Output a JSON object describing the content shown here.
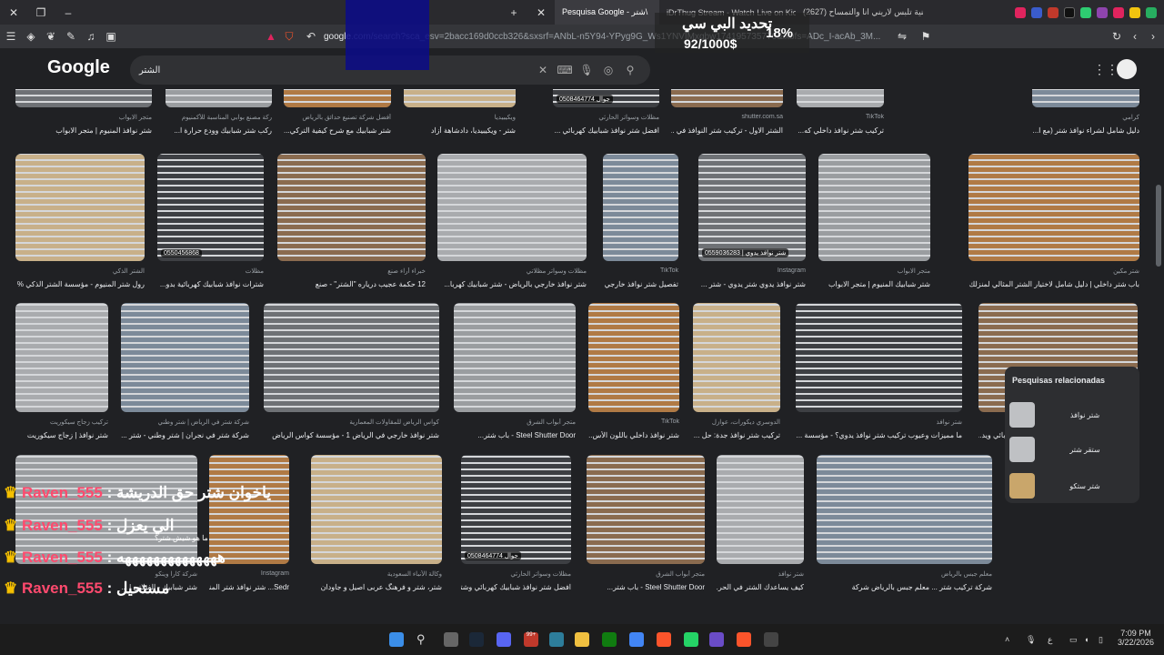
{
  "browser": {
    "tabs": [
      {
        "label": "",
        "active": false
      },
      {
        "label": "Pesquisa Google - شتر\\",
        "active": true
      },
      {
        "label": "iDrThug Stream - Watch Live on Kick",
        "active": false
      },
      {
        "label": "(2627) اغنية تلبس لاريني انا والتمساح",
        "active": false
      }
    ],
    "url_host": "google",
    "url_rest": ".com/search?sca_esv=2bacc169d0ccb326&sxsrf=ANbL-n5Y94-YPyg9G_Ws1YNVIMxgbw174195735776&ixbfs=ADc_I-acAb_3M..."
  },
  "google": {
    "logo": "Google",
    "query": "الشتر"
  },
  "overlay": {
    "line1": "تحديد البي سي",
    "line2": "92/1000$",
    "percent": "18%"
  },
  "results": {
    "row0": [
      {
        "src": "متجر الابواب",
        "title": "شتر نوافذ المنيوم | متجر الابواب"
      },
      {
        "src": "ركة مصنع بوابي المناسبة للأكمنيوم",
        "title": "ركب شتر شبابيك وودع حرارة ا..."
      },
      {
        "src": "أفضل شركة تصنيع حدائق بالرياض",
        "title": "شتر شبابيك مع شرح كيفية التركي..."
      },
      {
        "src": "ويكيبيديا",
        "title": "شتر - ويكيبيديا، دادشاهة أزاد"
      },
      {
        "src": "مظلات وسواتر الحارثي",
        "title": "افضل شتر نوافذ شبابيك كهربائي ..."
      },
      {
        "src": "shutter.com.sa",
        "title": "الشتر الاول - تركيب شتر النوافذ في ..."
      },
      {
        "src": "TikTok",
        "title": "تركيب شتر نوافذ داخلي كه..."
      },
      {
        "src": "كرامي",
        "title": "دليل شامل لشراء نوافذ شتر (مع ا..."
      }
    ],
    "row1": [
      {
        "src": "الشتر الذكي",
        "title": "رول شتر المنيوم - مؤسسة الشتر الذكي %"
      },
      {
        "src": "مظلات",
        "title": "شترات نوافذ شبابيك كهربائية بدو..."
      },
      {
        "src": "خبراء أراء صنع",
        "title": "12 حكمة عجيب درياره \"الشتر\" - صنع"
      },
      {
        "src": "مظلات وسواتر مظلاتي",
        "title": "شتر نوافذ خارجي بالرياض - شتر شبابيك كهربا..."
      },
      {
        "src": "TikTok",
        "title": "تفصيل شتر نوافذ خارجي ..."
      },
      {
        "src": "Instagram",
        "title": "شتر نوافذ يدوي شتر يدوي - شتر ..."
      },
      {
        "src": "متجر الابواب",
        "title": "شتر شبابيك المنيوم | متجر الابواب"
      },
      {
        "src": "شتر مكين",
        "title": "باب شتر داخلي | دليل شامل لاختيار الشتر المثالي لمنزلك"
      }
    ],
    "row2": [
      {
        "src": "تركيب زجاج سيكوريت",
        "title": "شتر نوافذ | زجاج سيكوريت"
      },
      {
        "src": "شركة شتر في الرياض | شتر وطني",
        "title": "شركة شتر في نجران | شتر وطني - شتر ..."
      },
      {
        "src": "كواس الرياض للمقاولات المعمارية",
        "title": "شتر نوافذ خارجي في الرياض 1 - مؤسسة كواس الرياض"
      },
      {
        "src": "متجر أبواب الشرق",
        "title": "Steel Shutter Door - باب شتر..."
      },
      {
        "src": "TikTok",
        "title": "شتر نوافذ داخلي باللون الأس..."
      },
      {
        "src": "الدوسري ديكورات، عوازل",
        "title": "تركيب شتر نوافذ جدة: حل ..."
      },
      {
        "src": "شتر نوافذ",
        "title": "ما مميزات وعيوب تركيب شتر نوافذ يدوي؟ - مؤسسة ..."
      },
      {
        "src": "مظلات وسواتر مظلاتي",
        "title": "شتر نوافذ خارجي بالرياض - شتر شبابيك كهربائي ويد..."
      }
    ],
    "row3": [
      {
        "src": "شركة كارا وينكو",
        "title": "شتر شبابيك - الفيلاتي | ..."
      },
      {
        "src": "Instagram",
        "title": "Sedr... شتر نوافذ شتر المنيوم"
      },
      {
        "src": "وكالة الأنباء السعودية",
        "title": "شتر، شتر و فرهنگ عربی اصیل و جاودان"
      },
      {
        "src": "مظلات وسواتر الحارثي",
        "title": "افضل شتر نوافذ شبابيك كهربائي وشتر..."
      },
      {
        "src": "متجر أبواب الشرق",
        "title": "Steel Shutter Door - باب شتر..."
      },
      {
        "src": "شتر نوافذ",
        "title": "كيف يساعدك الشتر في الحر..."
      },
      {
        "src": "معلم جبس بالرياض",
        "title": "شركة تركيب شتر ... معلم جبس بالرياض شركة"
      }
    ],
    "badges": {
      "r0c4": "0508464774 جوال",
      "r1c1": "0550456868",
      "r1c5": "0559036283 | شتر نوافذ يدوي",
      "r3c3": "0508464774 جوال"
    }
  },
  "related": {
    "heading": "Pesquisas relacionadas",
    "items": [
      "شتر نوافذ",
      "ستقر شتر",
      "شتر ستكو"
    ]
  },
  "chat": [
    {
      "user": "Raven_555",
      "msg": ": ياخوان شتر حق الدريشة"
    },
    {
      "user": "Raven_555",
      "msg": ": الي يعزل"
    },
    {
      "user": "Raven_555",
      "msg": ": ههههههههههههههه"
    },
    {
      "user": "Raven_555",
      "msg": ": مستحيل"
    }
  ],
  "chat_sub": "ما هو شيش شتر؟",
  "taskbar": {
    "time": "7:09 PM",
    "date": "3/22/2026",
    "lang": "ع",
    "badge": "99+"
  },
  "colors": {
    "bg": "#202124",
    "chat_user": "#ff4a6e",
    "accent_orange": "#f28b30"
  }
}
